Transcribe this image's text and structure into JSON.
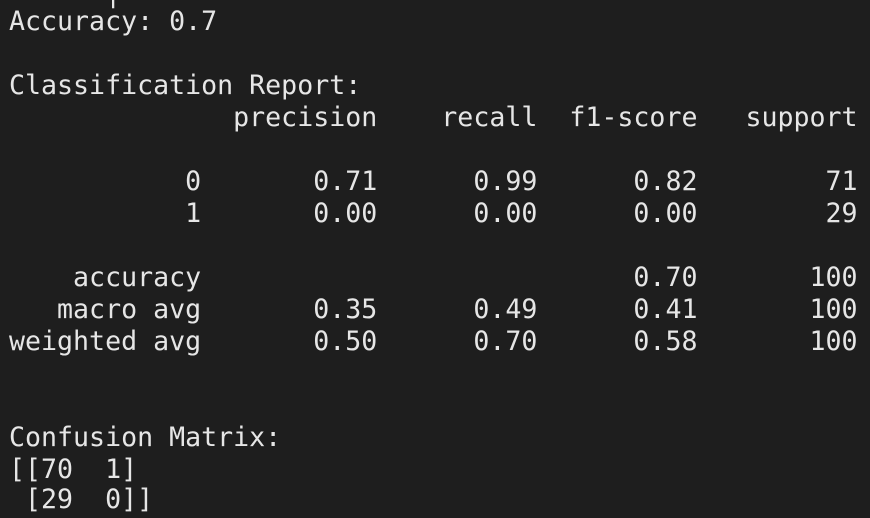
{
  "terminal": {
    "clipped_top_line": "      |",
    "lines": [
      "Accuracy: 0.7",
      "",
      "Classification Report:",
      "              precision    recall  f1-score   support",
      "",
      "           0       0.71      0.99      0.82        71",
      "           1       0.00      0.00      0.00        29",
      "",
      "    accuracy                           0.70       100",
      "   macro avg       0.35      0.49      0.41       100",
      "weighted avg       0.50      0.70      0.58       100",
      "",
      "",
      "Confusion Matrix:",
      "[[70  1]",
      " [29  0]]"
    ]
  }
}
